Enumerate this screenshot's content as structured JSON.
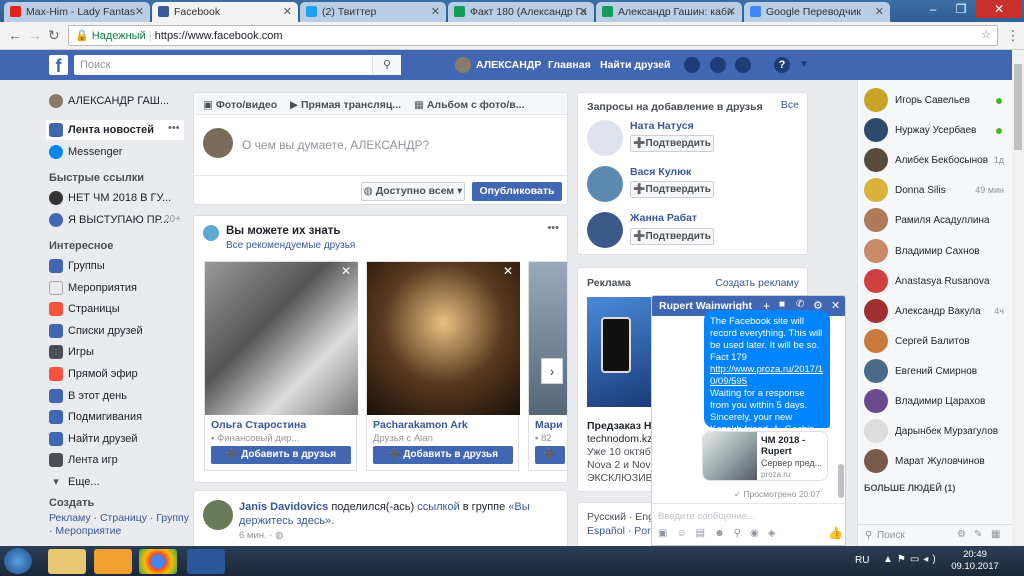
{
  "browser": {
    "tabs": [
      {
        "title": "Max-Him - Lady Fantas",
        "color": "#e62117"
      },
      {
        "title": "Facebook",
        "color": "#3b5998"
      },
      {
        "title": "(2) Твиттер",
        "color": "#1da1f2"
      },
      {
        "title": "Факт 180 (Александр Га",
        "color": "#0f9d58"
      },
      {
        "title": "Александр Гашин: каби",
        "color": "#0f9d58"
      },
      {
        "title": "Google Переводчик",
        "color": "#4285f4"
      }
    ],
    "secure_label": "Надежный",
    "url": "https://www.facebook.com"
  },
  "header": {
    "search_placeholder": "Поиск",
    "user_name": "АЛЕКСАНДР",
    "home": "Главная",
    "find_friends": "Найти друзей"
  },
  "left": {
    "profile_name": "АЛЕКСАНДР ГАШ...",
    "news_feed": "Лента новостей",
    "messenger": "Messenger",
    "quick_links_title": "Быстрые ссылки",
    "quick_links": [
      {
        "label": "НЕТ ЧМ 2018 В ГУ...",
        "count": ""
      },
      {
        "label": "Я ВЫСТУПАЮ ПР...",
        "count": "20+"
      }
    ],
    "interesting_title": "Интересное",
    "interesting": [
      "Группы",
      "Мероприятия",
      "Страницы",
      "Списки друзей",
      "Игры",
      "Прямой эфир",
      "В этот день",
      "Подмигивания",
      "Найти друзей",
      "Лента игр",
      "Еще..."
    ],
    "create_title": "Создать",
    "create_links": "Рекламу · Страницу · Группу · Мероприятие"
  },
  "composer": {
    "tab_photo": "Фото/видео",
    "tab_live": "Прямая трансляц...",
    "tab_album": "Альбом с фото/в...",
    "placeholder": "О чем вы думаете, АЛЕКСАНДР?",
    "privacy": "Доступно всем",
    "publish": "Опубликовать"
  },
  "pymk": {
    "title": "Вы можете их знать",
    "subtitle": "Все рекомендуемые друзья",
    "people": [
      {
        "name": "Ольга Старостина",
        "info": "Финансовый дир..."
      },
      {
        "name": "Pacharakamon Ark",
        "info": "Друзья с Alan"
      },
      {
        "name": "Мари",
        "info": "82"
      }
    ],
    "add_label": "Добавить в друзья"
  },
  "post": {
    "author": "Janis Davidovics",
    "action": "поделился(-ась)",
    "link": "ссылкой",
    "in_group": "в группе",
    "group": "«Вы держитесь здесь».",
    "time": "6 мин."
  },
  "requests": {
    "title": "Запросы на добавление в друзья",
    "all": "Все",
    "items": [
      "Ната Натуся",
      "Вася Кулюк",
      "Жанна Рабат"
    ],
    "confirm": "Подтвердить"
  },
  "ads": {
    "title": "Реклама",
    "create": "Создать рекламу",
    "ad_title": "Предзаказ Hu",
    "ad_domain": "technodom.kz",
    "ad_text_1": "Уже 10 октябр",
    "ad_text_2": "Nova 2 и Nova",
    "ad_text_3": "ЭКСКЛЮЗИВН"
  },
  "langs": {
    "line1": "Русский · Engl",
    "line2": "Español · Portu"
  },
  "chat_window": {
    "name": "Rupert Wainwright",
    "message": "The Facebook site will record everything. This will be used later. It will be so. Fact 179",
    "link": "http://www.proza.ru/2017/10/09/595",
    "message2": "Waiting for a response from you within 5 days. Sincerely, your new Kazakh friend, A. Gashin.",
    "preview_title": "ЧМ 2018 - Rupert",
    "preview_sub": "Сервер пред...",
    "preview_domain": "proza.ru",
    "seen": "Просмотрено 20:07",
    "input_placeholder": "Введите сообщение..."
  },
  "contacts": [
    {
      "name": "Игорь Савельев",
      "status": "online",
      "color": "#c9a227"
    },
    {
      "name": "Нуржау Усербаев",
      "status": "online",
      "color": "#2d4a6b"
    },
    {
      "name": "Алибек Бекбосынов",
      "status": "1д",
      "color": "#5a4a3a"
    },
    {
      "name": "Donna Silis",
      "status": "49 мин",
      "color": "#d9b23a"
    },
    {
      "name": "Рамиля Асадуллина",
      "status": "",
      "color": "#b07a5a"
    },
    {
      "name": "Владимир Сахнов",
      "status": "",
      "color": "#c98a6a"
    },
    {
      "name": "Anastasya Rusanova",
      "status": "",
      "color": "#d04040"
    },
    {
      "name": "Александр Вакула",
      "status": "4ч",
      "color": "#a03030"
    },
    {
      "name": "Сергей Балитов",
      "status": "",
      "color": "#c87a3a"
    },
    {
      "name": "Евгений Смирнов",
      "status": "",
      "color": "#4a6a8a"
    },
    {
      "name": "Владимир Царахов",
      "status": "",
      "color": "#6a4a8a"
    },
    {
      "name": "Дарынбек Мурзагулов",
      "status": "",
      "color": "#dddddd"
    },
    {
      "name": "Марат Жуловчинов",
      "status": "",
      "color": "#7a5a4a"
    }
  ],
  "more_people": "БОЛЬШЕ ЛЮДЕЙ (1)",
  "chat_search": "Поиск",
  "taskbar": {
    "lang": "RU",
    "time": "20:49",
    "date": "09.10.2017"
  }
}
